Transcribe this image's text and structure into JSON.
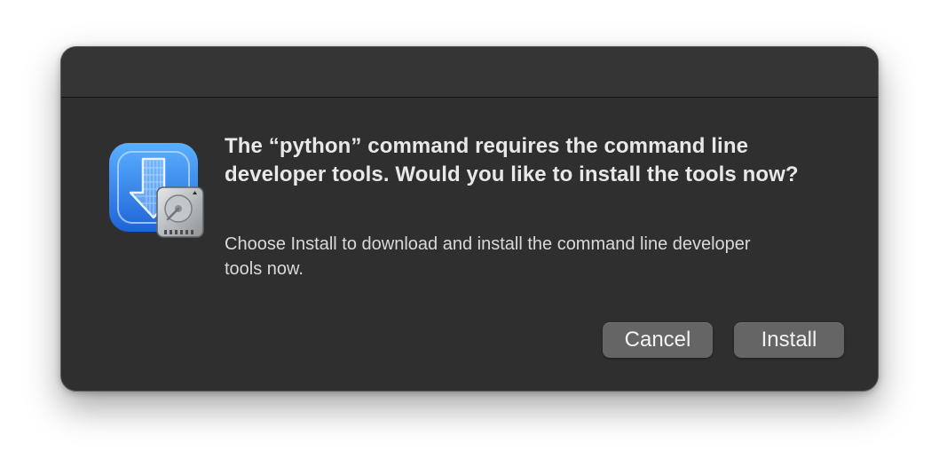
{
  "dialog": {
    "title": "The “python” command requires the command line developer tools. Would you like to install the tools now?",
    "message": "Choose Install to download and install the command line developer tools now.",
    "buttons": {
      "cancel_label": "Cancel",
      "install_label": "Install"
    },
    "icon": "install-developer-tools-icon"
  },
  "colors": {
    "dialog_background": "#2f2f2f",
    "titlebar_background": "#353535",
    "button_background": "#656565",
    "icon_blue": "#2f7ce6"
  }
}
